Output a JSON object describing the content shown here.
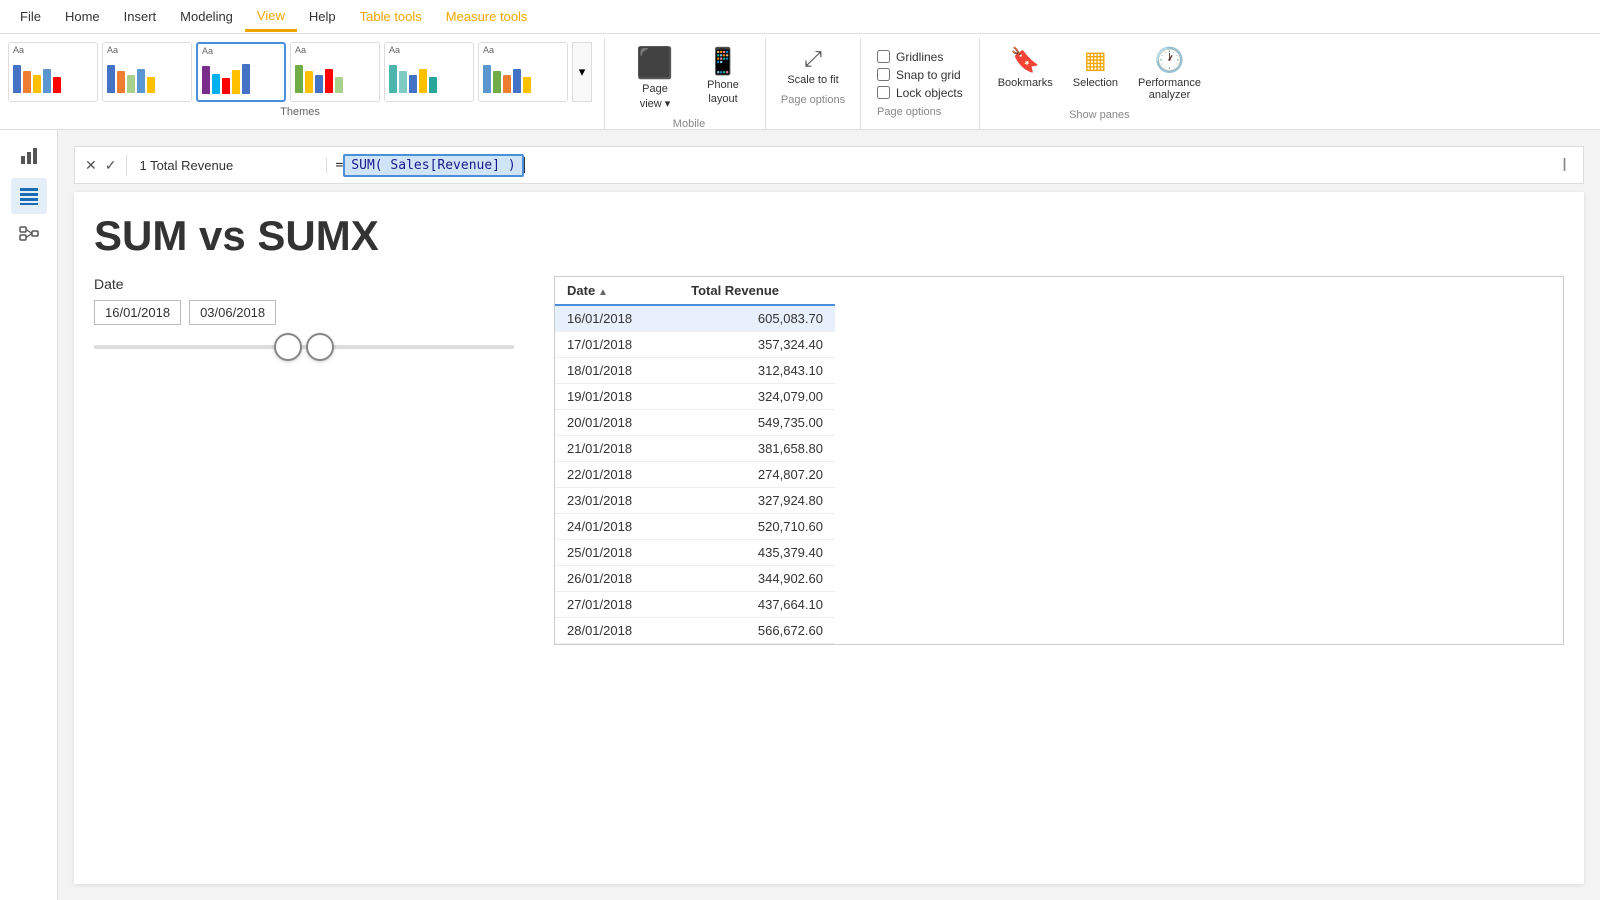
{
  "menu": {
    "items": [
      {
        "label": "File",
        "active": false
      },
      {
        "label": "Home",
        "active": false
      },
      {
        "label": "Insert",
        "active": false
      },
      {
        "label": "Modeling",
        "active": false
      },
      {
        "label": "View",
        "active": true
      },
      {
        "label": "Help",
        "active": false
      },
      {
        "label": "Table tools",
        "active": false,
        "color": "orange"
      },
      {
        "label": "Measure tools",
        "active": false,
        "color": "orange"
      }
    ]
  },
  "ribbon": {
    "themes_label": "Themes",
    "page_view_label": "Page view",
    "page_view_btn": "Page\nview",
    "phone_layout_label": "Phone layout",
    "phone_layout_line1": "Phone",
    "phone_layout_line2": "layout",
    "mobile_label": "Mobile",
    "scale_to_fit_label": "Scale to fit",
    "page_options_label": "Page options",
    "gridlines_label": "Gridlines",
    "snap_to_grid_label": "Snap to grid",
    "lock_objects_label": "Lock objects",
    "show_panes_label": "Show panes",
    "bookmarks_label": "Bookmarks",
    "selection_label": "Selection",
    "performance_analyzer_label": "Performance\nanalyzer"
  },
  "formula_bar": {
    "measure_name": "1  Total Revenue",
    "formula_prefix": "= ",
    "formula_highlight": "SUM( Sales[Revenue] )",
    "has_cursor": true
  },
  "report": {
    "title": "SUM vs SUMX",
    "date_slicer": {
      "label": "Date",
      "date_from": "16/01/2018",
      "date_to": "03/06/2018"
    },
    "table": {
      "headers": [
        "Date",
        "Total Revenue"
      ],
      "rows": [
        {
          "date": "16/01/2018",
          "revenue": "605,083.70",
          "highlighted": true
        },
        {
          "date": "17/01/2018",
          "revenue": "357,324.40"
        },
        {
          "date": "18/01/2018",
          "revenue": "312,843.10"
        },
        {
          "date": "19/01/2018",
          "revenue": "324,079.00"
        },
        {
          "date": "20/01/2018",
          "revenue": "549,735.00"
        },
        {
          "date": "21/01/2018",
          "revenue": "381,658.80"
        },
        {
          "date": "22/01/2018",
          "revenue": "274,807.20"
        },
        {
          "date": "23/01/2018",
          "revenue": "327,924.80"
        },
        {
          "date": "24/01/2018",
          "revenue": "520,710.60"
        },
        {
          "date": "25/01/2018",
          "revenue": "435,379.40"
        },
        {
          "date": "26/01/2018",
          "revenue": "344,902.60"
        },
        {
          "date": "27/01/2018",
          "revenue": "437,664.10"
        },
        {
          "date": "28/01/2018",
          "revenue": "566,672.60"
        }
      ]
    }
  },
  "themes": [
    {
      "bars": [
        "#4472c4",
        "#ed7d31",
        "#ffc000",
        "#5a96d0",
        "#ff0000"
      ],
      "label": "Aa"
    },
    {
      "bars": [
        "#4472c4",
        "#ed7d31",
        "#a9d18e",
        "#5a96d0",
        "#ffc000"
      ],
      "label": "Aa"
    },
    {
      "bars": [
        "#7b2d8b",
        "#00b0f0",
        "#ff0000",
        "#ffc000",
        "#4472c4"
      ],
      "label": "Aa",
      "selected": true
    },
    {
      "bars": [
        "#70ad47",
        "#ffc000",
        "#4472c4",
        "#ff0000",
        "#a9d18e"
      ],
      "label": "Aa"
    },
    {
      "bars": [
        "#4db6ac",
        "#80cbc4",
        "#4472c4",
        "#ffc000",
        "#26a69a"
      ],
      "label": "Aa"
    },
    {
      "bars": [
        "#5a96d0",
        "#70ad47",
        "#ed7d31",
        "#4472c4",
        "#ffc000"
      ],
      "label": "Aa"
    }
  ]
}
